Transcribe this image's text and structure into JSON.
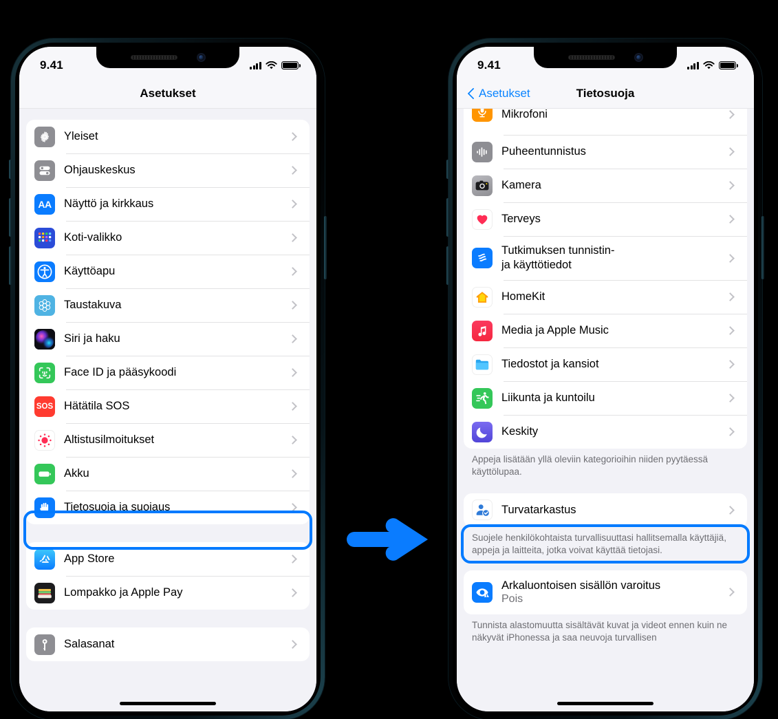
{
  "meta": {
    "accent_blue": "#007aff",
    "bg_black": "#000000",
    "screen_bg": "#f2f2f7"
  },
  "arrow": {
    "name": "step-arrow",
    "direction": "right",
    "color": "#0a7cff"
  },
  "phone_left": {
    "status_bar": {
      "time": "9.41",
      "signal": "signal-bars-icon",
      "wifi": "wifi-icon",
      "battery": "battery-full-icon"
    },
    "nav": {
      "title": "Asetukset"
    },
    "groups": [
      {
        "rows": [
          {
            "label": "Yleiset",
            "icon": "gear-icon",
            "icon_bg": "#8e8e93"
          },
          {
            "label": "Ohjauskeskus",
            "icon": "control-center-icon",
            "icon_bg": "#8e8e93"
          },
          {
            "label": "Näyttö ja kirkkaus",
            "icon": "display-brightness-icon",
            "icon_bg": "#0a7cff"
          },
          {
            "label": "Koti-valikko",
            "icon": "home-screen-icon",
            "icon_bg": "#2b4cd8"
          },
          {
            "label": "Käyttöapu",
            "icon": "accessibility-icon",
            "icon_bg": "#0a7cff"
          },
          {
            "label": "Taustakuva",
            "icon": "wallpaper-icon",
            "icon_bg": "#4fb3e3"
          },
          {
            "label": "Siri ja haku",
            "icon": "siri-icon",
            "icon_bg": "#1c1c1e"
          },
          {
            "label": "Face ID ja pääsykoodi",
            "icon": "face-id-icon",
            "icon_bg": "#34c759"
          },
          {
            "label": "Hätätila SOS",
            "icon": "sos-icon",
            "icon_bg": "#ff3b30"
          },
          {
            "label": "Altistusilmoitukset",
            "icon": "exposure-notifications-icon",
            "icon_bg": "#ffffff"
          },
          {
            "label": "Akku",
            "icon": "battery-icon",
            "icon_bg": "#34c759"
          },
          {
            "label": "Tietosuoja ja suojaus",
            "icon": "privacy-hand-icon",
            "icon_bg": "#0a7cff",
            "highlighted": true
          }
        ]
      },
      {
        "rows": [
          {
            "label": "App Store",
            "icon": "app-store-icon",
            "icon_bg": "#1da1f2"
          },
          {
            "label": "Lompakko ja Apple Pay",
            "icon": "wallet-icon",
            "icon_bg": "#1c1c1e"
          }
        ]
      },
      {
        "rows": [
          {
            "label": "Salasanat",
            "icon": "passwords-key-icon",
            "icon_bg": "#8e8e93"
          }
        ]
      }
    ]
  },
  "phone_right": {
    "status_bar": {
      "time": "9.41",
      "signal": "signal-bars-icon",
      "wifi": "wifi-icon",
      "battery": "battery-full-icon"
    },
    "nav": {
      "back_label": "Asetukset",
      "title": "Tietosuoja"
    },
    "groups": [
      {
        "rows": [
          {
            "label": "Mikrofoni",
            "icon": "microphone-icon",
            "icon_bg": "#ff9500",
            "partial": true
          },
          {
            "label": "Puheentunnistus",
            "icon": "speech-recognition-icon",
            "icon_bg": "#8e8e93"
          },
          {
            "label": "Kamera",
            "icon": "camera-icon",
            "icon_bg": "#8e8e93"
          },
          {
            "label": "Terveys",
            "icon": "health-heart-icon",
            "icon_bg": "#ffffff"
          },
          {
            "label": "Tutkimuksen tunnistin-\nja käyttötiedot",
            "icon": "research-sensor-icon",
            "icon_bg": "#0a7cff",
            "two_line": true
          },
          {
            "label": "HomeKit",
            "icon": "homekit-icon",
            "icon_bg": "#ffffff"
          },
          {
            "label": "Media ja Apple Music",
            "icon": "apple-music-icon",
            "icon_bg": "#fa2d48"
          },
          {
            "label": "Tiedostot ja kansiot",
            "icon": "files-folder-icon",
            "icon_bg": "#ffffff"
          },
          {
            "label": "Liikunta ja kuntoilu",
            "icon": "fitness-icon",
            "icon_bg": "#34c759"
          },
          {
            "label": "Keskity",
            "icon": "focus-moon-icon",
            "icon_bg": "#5e5ce6"
          }
        ],
        "footnote": "Appeja lisätään yllä oleviin kategorioihin niiden pyytäessä käyttölupaa."
      },
      {
        "rows": [
          {
            "label": "Turvatarkastus",
            "icon": "safety-check-icon",
            "icon_bg": "#ffffff",
            "highlighted": true
          }
        ],
        "footnote": "Suojele henkilökohtaista turvallisuuttasi hallitsemalla käyttäjiä, appeja ja laitteita, jotka voivat käyttää tietojasi."
      },
      {
        "rows": [
          {
            "label": "Arkaluontoisen sisällön varoitus",
            "sub": "Pois",
            "icon": "sensitive-content-icon",
            "icon_bg": "#0a7cff",
            "two_line": true
          }
        ],
        "footnote": "Tunnista alastomuutta sisältävät kuvat ja videot ennen kuin ne näkyvät iPhonessa ja saa neuvoja turvallisen"
      }
    ]
  }
}
